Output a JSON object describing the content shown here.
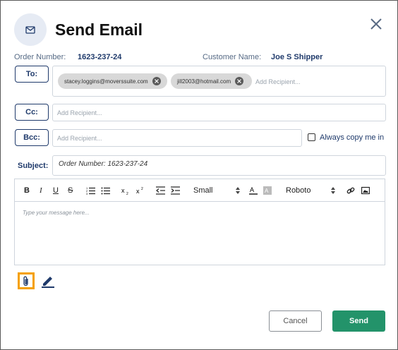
{
  "dialog": {
    "title": "Send Email",
    "header_icon": "envelope-icon",
    "close_icon": "close-icon"
  },
  "order": {
    "label": "Order Number:",
    "value": "1623-237-24"
  },
  "customer": {
    "label": "Customer Name:",
    "value": "Joe S Shipper"
  },
  "to": {
    "label": "To:",
    "recipients": [
      "stacey.loggins@moverssuite.com",
      "jill2003@hotmail.com"
    ],
    "placeholder": "Add Recipient..."
  },
  "cc": {
    "label": "Cc:",
    "placeholder": "Add Recipient..."
  },
  "bcc": {
    "label": "Bcc:",
    "placeholder": "Add Recipient..."
  },
  "always_copy": {
    "label": "Always copy me in",
    "checked": false
  },
  "subject": {
    "label": "Subject:",
    "value": "Order Number: 1623-237-24"
  },
  "editor": {
    "size_select": "Small",
    "font_select": "Roboto",
    "placeholder": "Type your message here..."
  },
  "actions": {
    "cancel": "Cancel",
    "send": "Send"
  },
  "colors": {
    "accent": "#1f3a6b",
    "send_button": "#23936a",
    "attach_highlight": "#f5a000"
  }
}
